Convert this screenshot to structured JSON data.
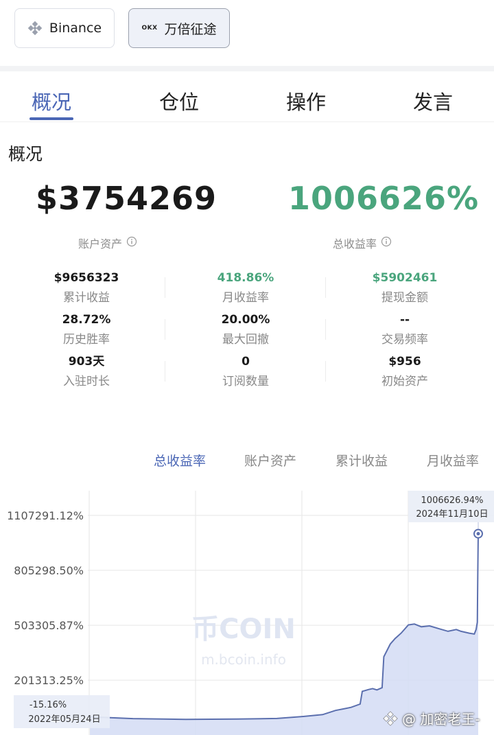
{
  "exchange_tabs": [
    {
      "label": "Binance",
      "active": false
    },
    {
      "label": "万倍征途",
      "logo_text": "OKX",
      "active": true
    }
  ],
  "nav_tabs": [
    {
      "label": "概况",
      "active": true
    },
    {
      "label": "仓位",
      "active": false
    },
    {
      "label": "操作",
      "active": false
    },
    {
      "label": "发言",
      "active": false
    }
  ],
  "section_title": "概况",
  "summary": {
    "account_assets": {
      "value": "$3754269",
      "label": "账户资产"
    },
    "total_return": {
      "value": "1006626%",
      "label": "总收益率"
    }
  },
  "stats": [
    {
      "value": "$9656323",
      "label": "累计收益",
      "color": "#1a1a1a"
    },
    {
      "value": "418.86%",
      "label": "月收益率",
      "color": "#4aa57d"
    },
    {
      "value": "$5902461",
      "label": "提现金额",
      "color": "#4aa57d"
    },
    {
      "value": "28.72%",
      "label": "历史胜率",
      "color": "#1a1a1a"
    },
    {
      "value": "20.00%",
      "label": "最大回撤",
      "color": "#1a1a1a"
    },
    {
      "value": "--",
      "label": "交易频率",
      "color": "#1a1a1a"
    },
    {
      "value": "903天",
      "label": "入驻时长",
      "color": "#1a1a1a"
    },
    {
      "value": "0",
      "label": "订阅数量",
      "color": "#1a1a1a"
    },
    {
      "value": "$956",
      "label": "初始资产",
      "color": "#1a1a1a"
    }
  ],
  "chart_tabs": [
    {
      "label": "总收益率",
      "active": true
    },
    {
      "label": "账户资产",
      "active": false
    },
    {
      "label": "累计收益",
      "active": false
    },
    {
      "label": "月收益率",
      "active": false
    }
  ],
  "watermark": {
    "brand": "币COIN",
    "url": "m.bcoin.info"
  },
  "bottom_watermark": "@ 加密老王-",
  "colors": {
    "accent": "#4a66b5",
    "positive": "#4aa57d",
    "line": "#5b6fae",
    "fill": "#d4dcf5"
  },
  "chart_data": {
    "type": "area",
    "title": "",
    "xlabel": "",
    "ylabel": "",
    "y_tick_labels": [
      "1107291.12%",
      "805298.50%",
      "503305.87%",
      "201313.25%"
    ],
    "y_ticks": [
      1107291.12,
      805298.5,
      503305.87,
      201313.25
    ],
    "ylim": [
      -100000,
      1107291.12
    ],
    "x_range": [
      "2022-05-24",
      "2024-11-10"
    ],
    "grid": true,
    "series": [
      {
        "x": [
          "2022-05-24",
          "2022-09-01",
          "2023-01-01",
          "2023-05-01",
          "2023-08-01",
          "2023-10-01",
          "2023-11-15",
          "2023-12-15",
          "2024-01-05",
          "2024-01-20",
          "2024-02-10",
          "2024-02-15",
          "2024-03-01",
          "2024-03-10",
          "2024-03-20",
          "2024-04-01",
          "2024-04-05",
          "2024-04-20",
          "2024-05-01",
          "2024-05-15",
          "2024-06-01",
          "2024-06-15",
          "2024-07-01",
          "2024-07-20",
          "2024-08-10",
          "2024-09-01",
          "2024-09-20",
          "2024-10-01",
          "2024-10-20",
          "2024-11-01",
          "2024-11-05",
          "2024-11-08",
          "2024-11-09",
          "2024-11-10"
        ],
        "y": [
          -15.16,
          -10000,
          -14000,
          -12000,
          -9000,
          2000,
          12000,
          35000,
          45000,
          52000,
          70000,
          140000,
          150000,
          155000,
          148000,
          160000,
          330000,
          400000,
          430000,
          460000,
          505000,
          510000,
          495000,
          500000,
          485000,
          470000,
          480000,
          470000,
          460000,
          455000,
          480000,
          520000,
          800000,
          1006626.94
        ]
      }
    ],
    "annotations": [
      {
        "x": "2024-11-10",
        "y": 1006626.94,
        "value_label": "1006626.94%",
        "date_label": "2024年11月10日"
      },
      {
        "x": "2022-05-24",
        "y": -15.16,
        "value_label": "-15.16%",
        "date_label": "2022年05月24日"
      }
    ]
  }
}
